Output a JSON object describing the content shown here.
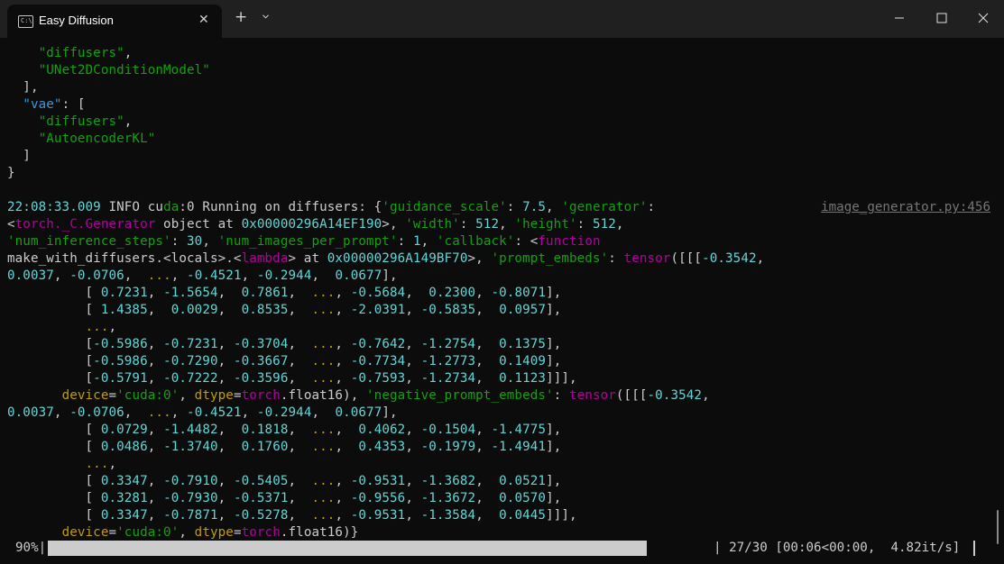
{
  "window": {
    "tab_title": "Easy Diffusion",
    "tab_icon": "terminal-icon",
    "icon_glyph": "C:\\",
    "close_tab": "✕",
    "new_tab": "+",
    "buttons": [
      "minimize-icon",
      "maximize-icon",
      "close-icon"
    ]
  },
  "colors": {
    "background": "#0c0c0c",
    "titlebar": "#202020",
    "text": "#cccccc",
    "green": "#13a10e",
    "blue": "#3a96dd",
    "cyan": "#61d6d6",
    "magenta": "#b4009e",
    "yellow": "#c19c00"
  },
  "lines": [
    [
      [
        "    ",
        "w"
      ],
      [
        "\"diffusers\"",
        "g"
      ],
      [
        ",",
        "w"
      ]
    ],
    [
      [
        "    ",
        "w"
      ],
      [
        "\"UNet2DConditionModel\"",
        "g"
      ]
    ],
    [
      [
        "  ],",
        "w"
      ]
    ],
    [
      [
        "  ",
        "w"
      ],
      [
        "\"vae\"",
        "c"
      ],
      [
        ": [",
        "w"
      ]
    ],
    [
      [
        "    ",
        "w"
      ],
      [
        "\"diffusers\"",
        "g"
      ],
      [
        ",",
        "w"
      ]
    ],
    [
      [
        "    ",
        "w"
      ],
      [
        "\"AutoencoderKL\"",
        "g"
      ]
    ],
    [
      [
        "  ]",
        "w"
      ]
    ],
    [
      [
        "}",
        "w"
      ]
    ],
    [],
    [
      [
        "22:08:33.009",
        "lc"
      ],
      [
        " INFO ",
        "w"
      ],
      [
        "cu",
        "w"
      ],
      [
        "da",
        "g"
      ],
      [
        ":0 Running on diffusers: {",
        "w"
      ],
      [
        "'guidance_scale'",
        "g"
      ],
      [
        ": ",
        "w"
      ],
      [
        "7.5",
        "lc"
      ],
      [
        ", ",
        "w"
      ],
      [
        "'generator'",
        "g"
      ],
      [
        ":",
        "w"
      ]
    ],
    [
      [
        "<",
        "w"
      ],
      [
        "torch._C.Generator",
        "m"
      ],
      [
        " object at ",
        "w"
      ],
      [
        "0x00000296A14EF190",
        "lc"
      ],
      [
        ">, ",
        "w"
      ],
      [
        "'width'",
        "g"
      ],
      [
        ": ",
        "w"
      ],
      [
        "512",
        "lc"
      ],
      [
        ", ",
        "w"
      ],
      [
        "'height'",
        "g"
      ],
      [
        ": ",
        "w"
      ],
      [
        "512",
        "lc"
      ],
      [
        ",",
        "w"
      ]
    ],
    [
      [
        "'num_inference_steps'",
        "g"
      ],
      [
        ": ",
        "w"
      ],
      [
        "30",
        "lc"
      ],
      [
        ", ",
        "w"
      ],
      [
        "'num_images_per_prompt'",
        "g"
      ],
      [
        ": ",
        "w"
      ],
      [
        "1",
        "lc"
      ],
      [
        ", ",
        "w"
      ],
      [
        "'callback'",
        "g"
      ],
      [
        ": <",
        "w"
      ],
      [
        "function",
        "m"
      ]
    ],
    [
      [
        "make_with_diffusers.<locals>.<",
        "w"
      ],
      [
        "lambda",
        "m"
      ],
      [
        "> at ",
        "w"
      ],
      [
        "0x00000296A149BF70",
        "lc"
      ],
      [
        ">, ",
        "w"
      ],
      [
        "'prompt_embeds'",
        "g"
      ],
      [
        ": ",
        "w"
      ],
      [
        "tensor",
        "m"
      ],
      [
        "([[[",
        "w"
      ],
      [
        "-0.3542",
        "lc"
      ],
      [
        ",",
        "w"
      ]
    ],
    [
      [
        "0.0037",
        "lc"
      ],
      [
        ", ",
        "w"
      ],
      [
        "-0.0706",
        "lc"
      ],
      [
        ",  ",
        "w"
      ],
      [
        "...",
        "y"
      ],
      [
        ", ",
        "w"
      ],
      [
        "-0.4521",
        "lc"
      ],
      [
        ", ",
        "w"
      ],
      [
        "-0.2944",
        "lc"
      ],
      [
        ",  ",
        "w"
      ],
      [
        "0.0677",
        "lc"
      ],
      [
        "],",
        "w"
      ]
    ],
    [
      [
        "          [ ",
        "w"
      ],
      [
        "0.7231",
        "lc"
      ],
      [
        ", ",
        "w"
      ],
      [
        "-1.5654",
        "lc"
      ],
      [
        ",  ",
        "w"
      ],
      [
        "0.7861",
        "lc"
      ],
      [
        ",  ",
        "w"
      ],
      [
        "...",
        "y"
      ],
      [
        ", ",
        "w"
      ],
      [
        "-0.5684",
        "lc"
      ],
      [
        ",  ",
        "w"
      ],
      [
        "0.2300",
        "lc"
      ],
      [
        ", ",
        "w"
      ],
      [
        "-0.8071",
        "lc"
      ],
      [
        "],",
        "w"
      ]
    ],
    [
      [
        "          [ ",
        "w"
      ],
      [
        "1.4385",
        "lc"
      ],
      [
        ",  ",
        "w"
      ],
      [
        "0.0029",
        "lc"
      ],
      [
        ",  ",
        "w"
      ],
      [
        "0.8535",
        "lc"
      ],
      [
        ",  ",
        "w"
      ],
      [
        "...",
        "y"
      ],
      [
        ", ",
        "w"
      ],
      [
        "-2.0391",
        "lc"
      ],
      [
        ", ",
        "w"
      ],
      [
        "-0.5835",
        "lc"
      ],
      [
        ",  ",
        "w"
      ],
      [
        "0.0957",
        "lc"
      ],
      [
        "],",
        "w"
      ]
    ],
    [
      [
        "          ",
        "w"
      ],
      [
        "...",
        "y"
      ],
      [
        ",",
        "w"
      ]
    ],
    [
      [
        "          [",
        "w"
      ],
      [
        "-0.5986",
        "lc"
      ],
      [
        ", ",
        "w"
      ],
      [
        "-0.7231",
        "lc"
      ],
      [
        ", ",
        "w"
      ],
      [
        "-0.3704",
        "lc"
      ],
      [
        ",  ",
        "w"
      ],
      [
        "...",
        "y"
      ],
      [
        ", ",
        "w"
      ],
      [
        "-0.7642",
        "lc"
      ],
      [
        ", ",
        "w"
      ],
      [
        "-1.2754",
        "lc"
      ],
      [
        ",  ",
        "w"
      ],
      [
        "0.1375",
        "lc"
      ],
      [
        "],",
        "w"
      ]
    ],
    [
      [
        "          [",
        "w"
      ],
      [
        "-0.5986",
        "lc"
      ],
      [
        ", ",
        "w"
      ],
      [
        "-0.7290",
        "lc"
      ],
      [
        ", ",
        "w"
      ],
      [
        "-0.3667",
        "lc"
      ],
      [
        ",  ",
        "w"
      ],
      [
        "...",
        "y"
      ],
      [
        ", ",
        "w"
      ],
      [
        "-0.7734",
        "lc"
      ],
      [
        ", ",
        "w"
      ],
      [
        "-1.2773",
        "lc"
      ],
      [
        ",  ",
        "w"
      ],
      [
        "0.1409",
        "lc"
      ],
      [
        "],",
        "w"
      ]
    ],
    [
      [
        "          [",
        "w"
      ],
      [
        "-0.5791",
        "lc"
      ],
      [
        ", ",
        "w"
      ],
      [
        "-0.7222",
        "lc"
      ],
      [
        ", ",
        "w"
      ],
      [
        "-0.3596",
        "lc"
      ],
      [
        ",  ",
        "w"
      ],
      [
        "...",
        "y"
      ],
      [
        ", ",
        "w"
      ],
      [
        "-0.7593",
        "lc"
      ],
      [
        ", ",
        "w"
      ],
      [
        "-1.2734",
        "lc"
      ],
      [
        ",  ",
        "w"
      ],
      [
        "0.1123",
        "lc"
      ],
      [
        "]]],",
        "w"
      ]
    ],
    [
      [
        "       ",
        "w"
      ],
      [
        "device",
        "y"
      ],
      [
        "=",
        "w"
      ],
      [
        "'cuda:0'",
        "g"
      ],
      [
        ", ",
        "w"
      ],
      [
        "dtype",
        "y"
      ],
      [
        "=",
        "w"
      ],
      [
        "torch",
        "m"
      ],
      [
        ".float16), ",
        "w"
      ],
      [
        "'negative_prompt_embeds'",
        "g"
      ],
      [
        ": ",
        "w"
      ],
      [
        "tensor",
        "m"
      ],
      [
        "([[[",
        "w"
      ],
      [
        "-0.3542",
        "lc"
      ],
      [
        ",",
        "w"
      ]
    ],
    [
      [
        "0.0037",
        "lc"
      ],
      [
        ", ",
        "w"
      ],
      [
        "-0.0706",
        "lc"
      ],
      [
        ",  ",
        "w"
      ],
      [
        "...",
        "y"
      ],
      [
        ", ",
        "w"
      ],
      [
        "-0.4521",
        "lc"
      ],
      [
        ", ",
        "w"
      ],
      [
        "-0.2944",
        "lc"
      ],
      [
        ",  ",
        "w"
      ],
      [
        "0.0677",
        "lc"
      ],
      [
        "],",
        "w"
      ]
    ],
    [
      [
        "          [ ",
        "w"
      ],
      [
        "0.0729",
        "lc"
      ],
      [
        ", ",
        "w"
      ],
      [
        "-1.4482",
        "lc"
      ],
      [
        ",  ",
        "w"
      ],
      [
        "0.1818",
        "lc"
      ],
      [
        ",  ",
        "w"
      ],
      [
        "...",
        "y"
      ],
      [
        ",  ",
        "w"
      ],
      [
        "0.4062",
        "lc"
      ],
      [
        ", ",
        "w"
      ],
      [
        "-0.1504",
        "lc"
      ],
      [
        ", ",
        "w"
      ],
      [
        "-1.4775",
        "lc"
      ],
      [
        "],",
        "w"
      ]
    ],
    [
      [
        "          [ ",
        "w"
      ],
      [
        "0.0486",
        "lc"
      ],
      [
        ", ",
        "w"
      ],
      [
        "-1.3740",
        "lc"
      ],
      [
        ",  ",
        "w"
      ],
      [
        "0.1760",
        "lc"
      ],
      [
        ",  ",
        "w"
      ],
      [
        "...",
        "y"
      ],
      [
        ",  ",
        "w"
      ],
      [
        "0.4353",
        "lc"
      ],
      [
        ", ",
        "w"
      ],
      [
        "-0.1979",
        "lc"
      ],
      [
        ", ",
        "w"
      ],
      [
        "-1.4941",
        "lc"
      ],
      [
        "],",
        "w"
      ]
    ],
    [
      [
        "          ",
        "w"
      ],
      [
        "...",
        "y"
      ],
      [
        ",",
        "w"
      ]
    ],
    [
      [
        "          [ ",
        "w"
      ],
      [
        "0.3347",
        "lc"
      ],
      [
        ", ",
        "w"
      ],
      [
        "-0.7910",
        "lc"
      ],
      [
        ", ",
        "w"
      ],
      [
        "-0.5405",
        "lc"
      ],
      [
        ",  ",
        "w"
      ],
      [
        "...",
        "y"
      ],
      [
        ", ",
        "w"
      ],
      [
        "-0.9531",
        "lc"
      ],
      [
        ", ",
        "w"
      ],
      [
        "-1.3682",
        "lc"
      ],
      [
        ",  ",
        "w"
      ],
      [
        "0.0521",
        "lc"
      ],
      [
        "],",
        "w"
      ]
    ],
    [
      [
        "          [ ",
        "w"
      ],
      [
        "0.3281",
        "lc"
      ],
      [
        ", ",
        "w"
      ],
      [
        "-0.7930",
        "lc"
      ],
      [
        ", ",
        "w"
      ],
      [
        "-0.5371",
        "lc"
      ],
      [
        ",  ",
        "w"
      ],
      [
        "...",
        "y"
      ],
      [
        ", ",
        "w"
      ],
      [
        "-0.9556",
        "lc"
      ],
      [
        ", ",
        "w"
      ],
      [
        "-1.3672",
        "lc"
      ],
      [
        ",  ",
        "w"
      ],
      [
        "0.0570",
        "lc"
      ],
      [
        "],",
        "w"
      ]
    ],
    [
      [
        "          [ ",
        "w"
      ],
      [
        "0.3347",
        "lc"
      ],
      [
        ", ",
        "w"
      ],
      [
        "-0.7871",
        "lc"
      ],
      [
        ", ",
        "w"
      ],
      [
        "-0.5278",
        "lc"
      ],
      [
        ",  ",
        "w"
      ],
      [
        "...",
        "y"
      ],
      [
        ", ",
        "w"
      ],
      [
        "-0.9531",
        "lc"
      ],
      [
        ", ",
        "w"
      ],
      [
        "-1.3584",
        "lc"
      ],
      [
        ",  ",
        "w"
      ],
      [
        "0.0445",
        "lc"
      ],
      [
        "]]],",
        "w"
      ]
    ],
    [
      [
        "       ",
        "w"
      ],
      [
        "device",
        "y"
      ],
      [
        "=",
        "w"
      ],
      [
        "'cuda:0'",
        "g"
      ],
      [
        ", ",
        "w"
      ],
      [
        "dtype",
        "y"
      ],
      [
        "=",
        "w"
      ],
      [
        "torch",
        "m"
      ],
      [
        ".float16)}",
        "w"
      ]
    ]
  ],
  "source_ref": "image_generator.py:456",
  "progress": {
    "percent_label": "90%|",
    "fraction": 0.9,
    "info": "| 27/30 [00:06<00:00,  4.82it/s]"
  }
}
